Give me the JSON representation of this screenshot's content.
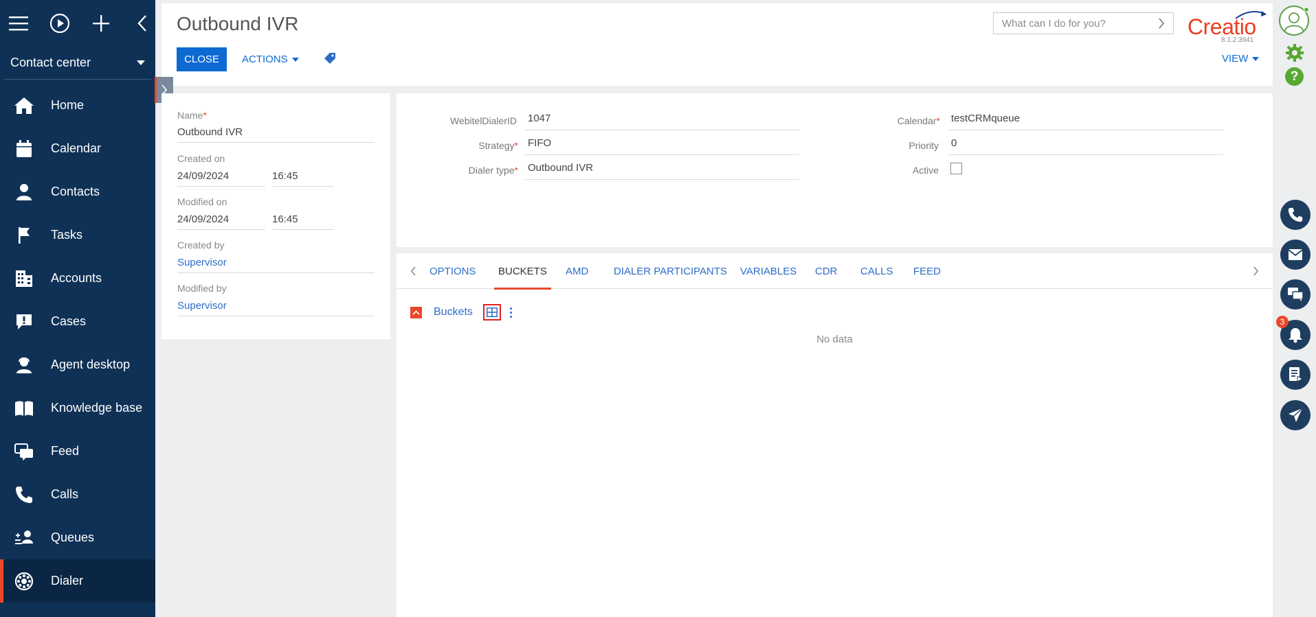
{
  "sidebar": {
    "workspace": "Contact center",
    "items": [
      {
        "label": "Home",
        "icon": "home-icon"
      },
      {
        "label": "Calendar",
        "icon": "calendar-icon"
      },
      {
        "label": "Contacts",
        "icon": "contact-icon"
      },
      {
        "label": "Tasks",
        "icon": "flag-icon"
      },
      {
        "label": "Accounts",
        "icon": "building-icon"
      },
      {
        "label": "Cases",
        "icon": "case-icon"
      },
      {
        "label": "Agent desktop",
        "icon": "agent-icon"
      },
      {
        "label": "Knowledge base",
        "icon": "book-icon"
      },
      {
        "label": "Feed",
        "icon": "feed-icon"
      },
      {
        "label": "Calls",
        "icon": "phone-icon"
      },
      {
        "label": "Queues",
        "icon": "queue-icon"
      },
      {
        "label": "Dialer",
        "icon": "dialer-icon",
        "active": true
      }
    ]
  },
  "header": {
    "title": "Outbound IVR",
    "close_label": "CLOSE",
    "actions_label": "ACTIONS",
    "view_label": "VIEW",
    "search_placeholder": "What can I do for you?",
    "logo_text": "Creatio",
    "version": "8.1.2.3941"
  },
  "leftcard": {
    "name_label": "Name",
    "name_value": "Outbound IVR",
    "created_on_label": "Created on",
    "created_on_date": "24/09/2024",
    "created_on_time": "16:45",
    "modified_on_label": "Modified on",
    "modified_on_date": "24/09/2024",
    "modified_on_time": "16:45",
    "created_by_label": "Created by",
    "created_by_value": "Supervisor",
    "modified_by_label": "Modified by",
    "modified_by_value": "Supervisor"
  },
  "details": {
    "webitel_label": "WebitelDialerID",
    "webitel_value": "1047",
    "strategy_label": "Strategy",
    "strategy_value": "FIFO",
    "dialer_type_label": "Dialer type",
    "dialer_type_value": "Outbound IVR",
    "calendar_label": "Calendar",
    "calendar_value": "testCRMqueue",
    "priority_label": "Priority",
    "priority_value": "0",
    "active_label": "Active"
  },
  "tabs": [
    {
      "label": "OPTIONS"
    },
    {
      "label": "BUCKETS",
      "active": true
    },
    {
      "label": "AMD"
    },
    {
      "label": "DIALER PARTICIPANTS"
    },
    {
      "label": "VARIABLES"
    },
    {
      "label": "CDR"
    },
    {
      "label": "CALLS"
    },
    {
      "label": "FEED"
    }
  ],
  "buckets": {
    "title": "Buckets",
    "empty_text": "No data"
  },
  "rail": {
    "notification_count": "3"
  },
  "colors": {
    "sidebar_bg": "#0f3156",
    "accent": "#e8482a",
    "primary_button": "#0d6ad3",
    "link": "#2c6cc9"
  }
}
